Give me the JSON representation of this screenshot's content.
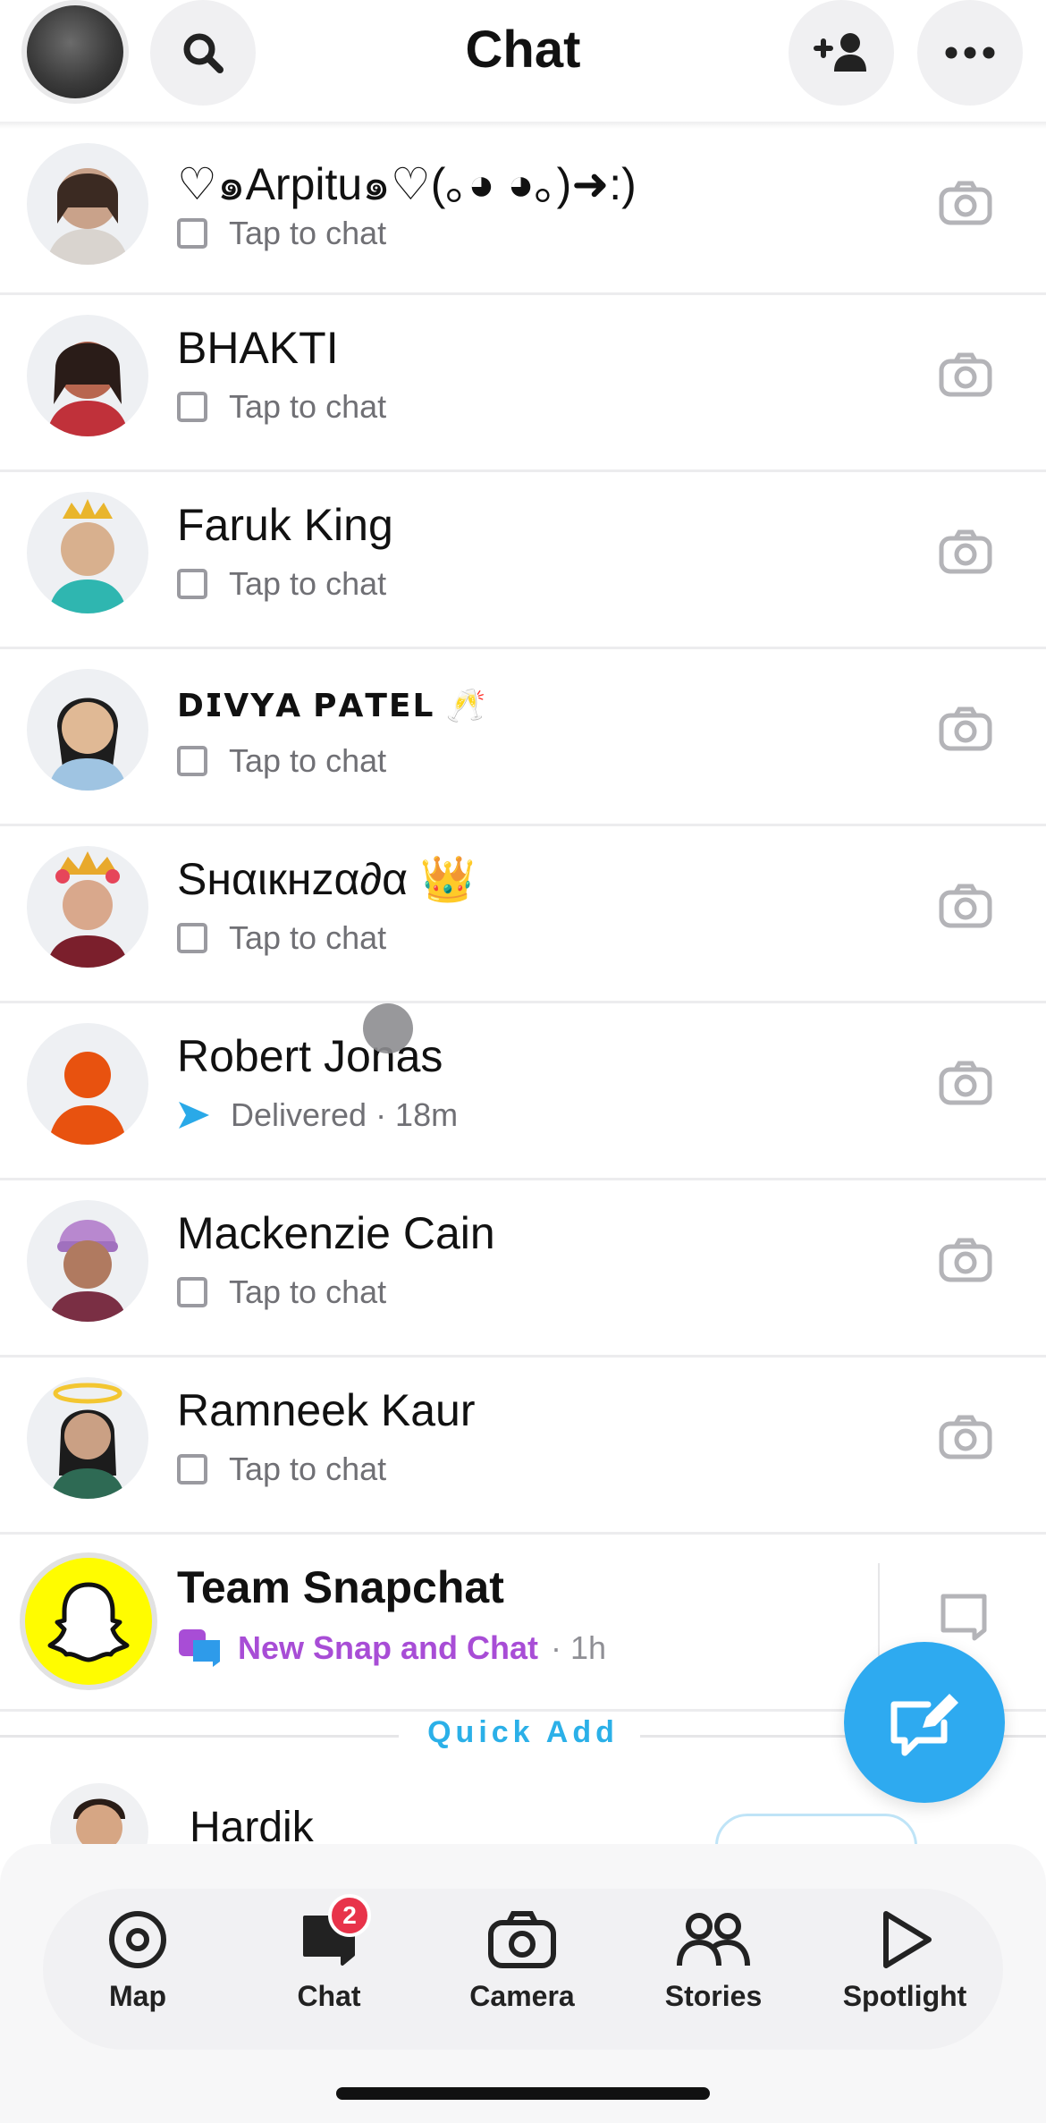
{
  "header": {
    "title": "Chat"
  },
  "chats": [
    {
      "name": "♡๑Arpitu๑♡(｡◕ ◕｡)➜:)",
      "status": "Tap to chat",
      "style": "normal",
      "avatar_color": "#c9a28a"
    },
    {
      "name": "BHAKTI",
      "status": "Tap to chat",
      "style": "normal",
      "avatar_color": "#b8664f"
    },
    {
      "name": "Faruk King",
      "status": "Tap to chat",
      "style": "normal",
      "avatar_color": "#d8b08e"
    },
    {
      "name": "𝗗𝗜𝗩𝗬𝗔 𝗣𝗔𝗧𝗘𝗟 🥂",
      "status": "Tap to chat",
      "style": "bold",
      "avatar_color": "#e0b995"
    },
    {
      "name": "Sнαιкнzα∂α 👑",
      "status": "Tap to chat",
      "style": "normal",
      "avatar_color": "#d9a88c"
    },
    {
      "name": "Robert Jonas",
      "status": "Delivered · 18m",
      "style": "delivered",
      "avatar_color": "#e8520f"
    },
    {
      "name": "Mackenzie Cain",
      "status": "Tap to chat",
      "style": "normal",
      "avatar_color": "#b07a60"
    },
    {
      "name": "Ramneek Kaur",
      "status": "Tap to chat",
      "style": "normal",
      "avatar_color": "#caa084"
    }
  ],
  "team_snapchat": {
    "name": "Team Snapchat",
    "status": "New Snap and Chat",
    "time": "· 1h"
  },
  "quick_add": {
    "label": "Quick Add",
    "first_name": "Hardik"
  },
  "nav": {
    "map": "Map",
    "chat": "Chat",
    "chat_badge": "2",
    "camera": "Camera",
    "stories": "Stories",
    "spotlight": "Spotlight"
  },
  "colors": {
    "accent_blue": "#2eaaf0",
    "badge_red": "#e8334a",
    "snap_yellow": "#fffc00",
    "purple": "#a84dd6"
  }
}
